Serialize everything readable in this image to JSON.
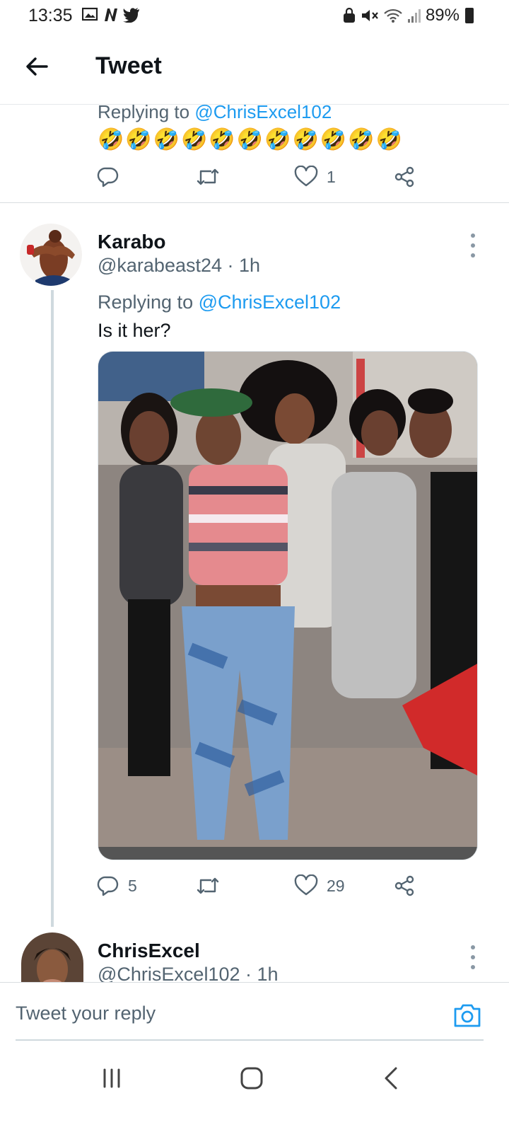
{
  "status_bar": {
    "time": "13:35",
    "battery": "89%",
    "left_icons": [
      "image-icon",
      "netflix-n-icon",
      "twitter-bird-icon"
    ],
    "right_icons": [
      "alarm-lock-icon",
      "mute-icon",
      "wifi-icon",
      "signal-icon",
      "battery-icon"
    ]
  },
  "header": {
    "title": "Tweet",
    "back_icon": "arrow-left-icon"
  },
  "previous_tweet": {
    "replying_prefix": "Replying to ",
    "replying_handle": "@ChrisExcel102",
    "text": "🤣🤣🤣🤣🤣🤣🤣🤣🤣🤣🤣",
    "actions": {
      "reply_count": "",
      "retweet_count": "",
      "like_count": "1"
    }
  },
  "main_tweet": {
    "display_name": "Karabo",
    "handle_time": "@karabeast24 · 1h",
    "replying_prefix": "Replying to ",
    "replying_handle": "@ChrisExcel102",
    "text": "Is it her?",
    "actions": {
      "reply_count": "5",
      "retweet_count": "",
      "like_count": "29"
    }
  },
  "next_tweet": {
    "display_name": "ChrisExcel",
    "handle_time": "@ChrisExcel102 · 1h"
  },
  "reply_bar": {
    "placeholder": "Tweet your reply"
  },
  "colors": {
    "accent": "#1d9bf0",
    "text_primary": "#0f1419",
    "text_secondary": "#536471",
    "divider": "#d9dde0"
  }
}
